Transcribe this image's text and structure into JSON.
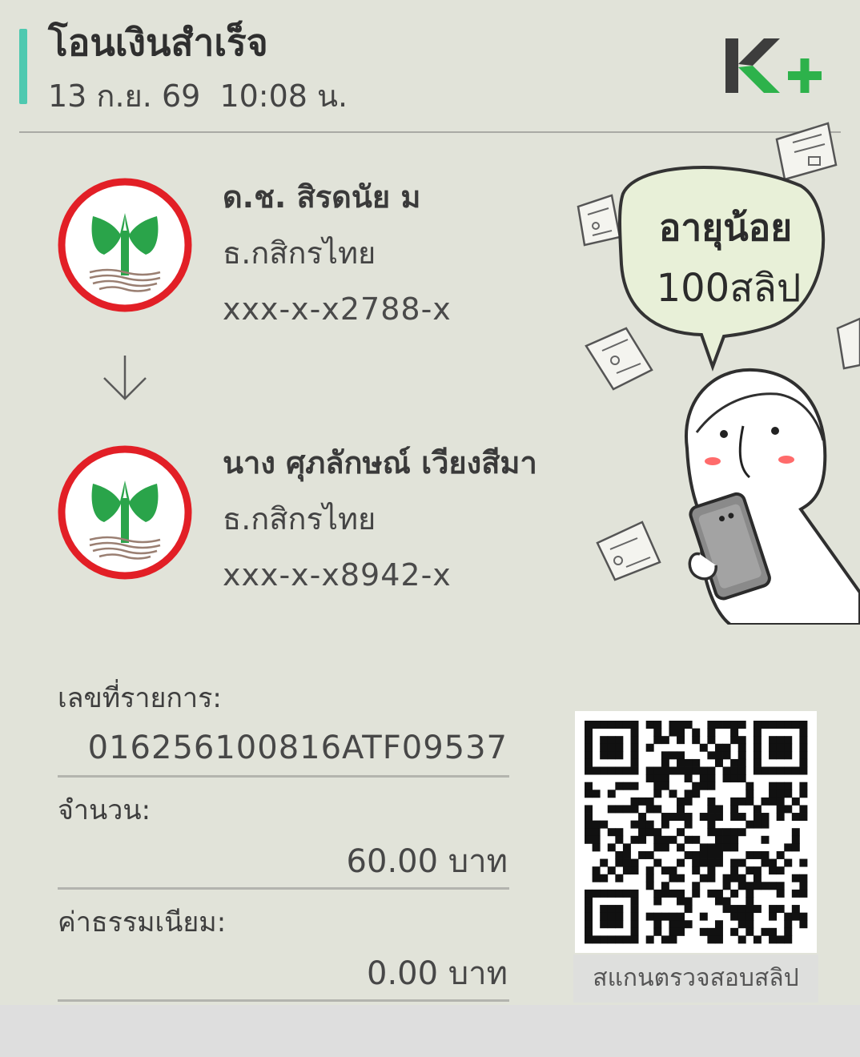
{
  "header": {
    "title": "โอนเงินสำเร็จ",
    "date": "13 ก.ย. 69",
    "time": "10:08 น.",
    "datetime": "13 ก.ย. 69  10:08 น.",
    "logo_text": "K+",
    "accent_color": "#4ec9b0",
    "brand_green": "#2db24b"
  },
  "sender": {
    "name": "ด.ช. สิรดนัย ม",
    "bank": "ธ.กสิกรไทย",
    "account": "xxx-x-x2788-x",
    "icon": "kasikorn-bank-logo"
  },
  "transfer_icon": "arrow-down-icon",
  "receiver": {
    "name": "นาง ศุภลักษณ์ เวียงสีมา",
    "bank": "ธ.กสิกรไทย",
    "account": "xxx-x-x8942-x",
    "icon": "kasikorn-bank-logo"
  },
  "details": {
    "ref_label": "เลขที่รายการ:",
    "ref_value": "016256100816ATF09537",
    "amount_label": "จำนวน:",
    "amount_value": "60.00 บาท",
    "fee_label": "ค่าธรรมเนียม:",
    "fee_value": "0.00 บาท"
  },
  "qr": {
    "caption": "สแกนตรวจสอบสลิป",
    "icon": "qr-code"
  },
  "sticker": {
    "speech_line1": "อายุน้อย",
    "speech_line2": "100สลิป",
    "icon": "mascot-with-phone-illustration"
  }
}
